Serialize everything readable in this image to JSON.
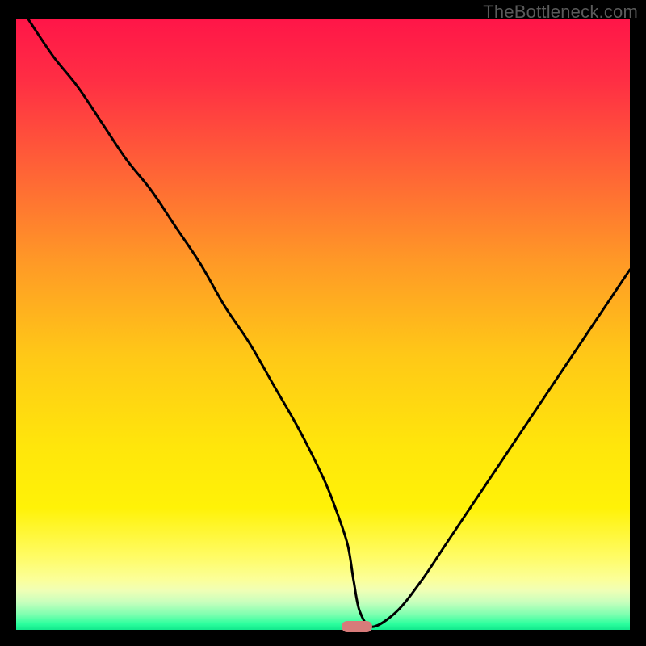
{
  "watermark": "TheBottleneck.com",
  "colors": {
    "background": "#000000",
    "curve": "#000000",
    "marker": "#d77b7a",
    "watermark_text": "#5a5a5a",
    "gradient_stops": [
      {
        "offset": 0.0,
        "color": "#ff1648"
      },
      {
        "offset": 0.1,
        "color": "#ff2e44"
      },
      {
        "offset": 0.25,
        "color": "#ff6436"
      },
      {
        "offset": 0.4,
        "color": "#ff9a26"
      },
      {
        "offset": 0.55,
        "color": "#ffc817"
      },
      {
        "offset": 0.7,
        "color": "#ffe60b"
      },
      {
        "offset": 0.8,
        "color": "#fff207"
      },
      {
        "offset": 0.88,
        "color": "#fffc65"
      },
      {
        "offset": 0.918,
        "color": "#fbff9a"
      },
      {
        "offset": 0.935,
        "color": "#f0ffb5"
      },
      {
        "offset": 0.955,
        "color": "#c7ffbd"
      },
      {
        "offset": 0.975,
        "color": "#7dffb0"
      },
      {
        "offset": 0.99,
        "color": "#2dff9e"
      },
      {
        "offset": 1.0,
        "color": "#12e88d"
      }
    ]
  },
  "chart_data": {
    "type": "line",
    "title": "",
    "xlabel": "",
    "ylabel": "",
    "xlim": [
      0,
      100
    ],
    "ylim": [
      0,
      100
    ],
    "grid": false,
    "legend": false,
    "series": [
      {
        "name": "bottleneck-curve",
        "x": [
          2,
          6,
          10,
          14,
          18,
          22,
          26,
          30,
          34,
          38,
          42,
          46,
          50,
          52,
          54,
          55,
          56,
          58,
          62,
          66,
          70,
          74,
          78,
          82,
          86,
          90,
          94,
          98,
          100
        ],
        "y": [
          100,
          94,
          89,
          83,
          77,
          72,
          66,
          60,
          53,
          47,
          40,
          33,
          25,
          20,
          14,
          8,
          3,
          0.5,
          3,
          8,
          14,
          20,
          26,
          32,
          38,
          44,
          50,
          56,
          59
        ]
      }
    ],
    "marker": {
      "x": 55.5,
      "y": 0.5,
      "width_pct": 5,
      "height_pct": 1.9
    }
  }
}
